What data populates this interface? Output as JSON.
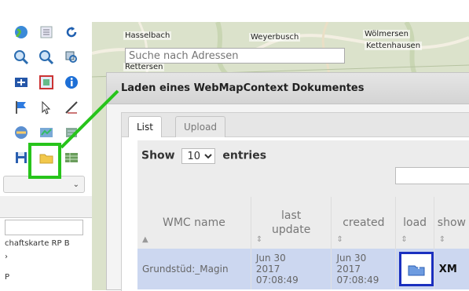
{
  "map": {
    "address_search": {
      "placeholder": "Suche nach Adressen"
    },
    "towns": [
      "Hasselbach",
      "Weyerbusch",
      "Wölmersen",
      "Kettenhausen",
      "Rettersen"
    ]
  },
  "dialog": {
    "title": "Laden eines WebMapContext Dokumentes",
    "tabs": [
      {
        "label": "List",
        "active": true
      },
      {
        "label": "Upload",
        "active": false
      }
    ],
    "length": {
      "prefix": "Show",
      "value": "10",
      "suffix": "entries"
    },
    "table": {
      "headers": [
        "WMC name",
        "last update",
        "created",
        "load",
        "show"
      ],
      "rows": [
        {
          "name": "Grundstüd:_Magin",
          "last_update": "Jun 30 2017 07:08:49",
          "created": "Jun 30 2017 07:08:49",
          "show": "XM"
        }
      ]
    }
  },
  "left_panel": {
    "line1": "chaftskarte RP B",
    "line2": "›",
    "line3": "P"
  },
  "colors": {
    "highlight_green": "#27c41b",
    "load_border": "#1a2fbf",
    "row_selected": "#ccd7f0"
  }
}
